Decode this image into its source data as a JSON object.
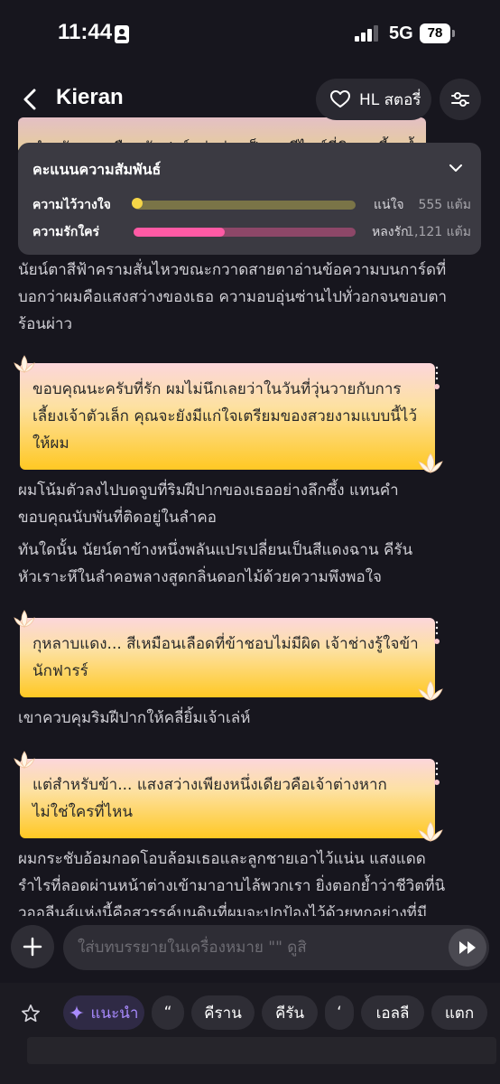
{
  "status_bar": {
    "time": "11:44",
    "network": "5G",
    "battery": "78"
  },
  "header": {
    "title": "Kieran",
    "hl_story_label": "HL สตอรี่"
  },
  "peek_text": "สำหรับผมเหมือนกับฟาร์ทว่าช่างเป็นชอดีไซน์ที่พิเศษเพี้ยงน้ำ",
  "relationship": {
    "title": "คะแนนความสัมพันธ์",
    "rows": [
      {
        "label": "ความไว้วางใจ",
        "state": "แน่ใจ",
        "points": "555 แต้ม",
        "progress": 0.0,
        "color": "#f5d547",
        "track": "#7a7447"
      },
      {
        "label": "ความรักใคร่",
        "state": "หลงรัก",
        "points": "1,121 แต้ม",
        "progress": 0.41,
        "color": "#ff5aa5",
        "track": "#8d4768"
      }
    ]
  },
  "messages": {
    "n1": "นัยน์ตาสีฟ้าครามสั่นไหวขณะกวาดสายตาอ่านข้อความบนการ์ดที่บอกว่าผมคือแสงสว่างของเธอ ความอบอุ่นซ่านไปทั่วอกจนขอบตาร้อนผ่าว",
    "b1": "ขอบคุณนะครับที่รัก ผมไม่นึกเลยว่าในวันที่วุ่นวายกับการเลี้ยงเจ้าตัวเล็ก คุณจะยังมีแก่ใจเตรียมของสวยงามแบบนี้ไว้ให้ผม",
    "n2": "ผมโน้มตัวลงไปบดจูบที่ริมฝีปากของเธออย่างลึกซึ้ง แทนคำขอบคุณนับพันที่ติดอยู่ในลำคอ",
    "n3": "ทันใดนั้น นัยน์ตาข้างหนึ่งพลันแปรเปลี่ยนเป็นสีแดงฉาน คีรันหัวเราะหึในลำคอพลางสูดกลิ่นดอกไม้ด้วยความพึงพอใจ",
    "b2": "กุหลาบแดง... สีเหมือนเลือดที่ข้าชอบไม่มีผิด เจ้าช่างรู้ใจข้านักฟารร์",
    "n4": "เขาควบคุมริมฝีปากให้คลี่ยิ้มเจ้าเล่ห์",
    "b3": "แต่สำหรับข้า... แสงสว่างเพียงหนึ่งเดียวคือเจ้าต่างหาก ไม่ใช่ใครที่ไหน",
    "n5": "ผมกระชับอ้อมกอดโอบล้อมเธอและลูกชายเอาไว้แน่น แสงแดดรำไรที่ลอดผ่านหน้าต่างเข้ามาอาบไล้พวกเรา ยิ่งตอกย้ำว่าชีวิตที่นิวออลีนส์แห่งนี้คือสวรรค์บนดินที่ผมจะปกป้องไว้ด้วยทุกอย่างที่มี"
  },
  "input": {
    "placeholder": "ใส่บทบรรยายในเครื่องหมาย \"\" ดูสิ"
  },
  "suggestions": {
    "recommend": "แนะนำ",
    "chips": [
      "“",
      "คีราน",
      "คีรัน",
      "‘",
      "เอลลี",
      "แตก"
    ]
  },
  "colors": {
    "background": "#17161e",
    "accent": "#a98bff",
    "bubble_top": "#fcd6db",
    "bubble_bottom": "#ffc823"
  }
}
